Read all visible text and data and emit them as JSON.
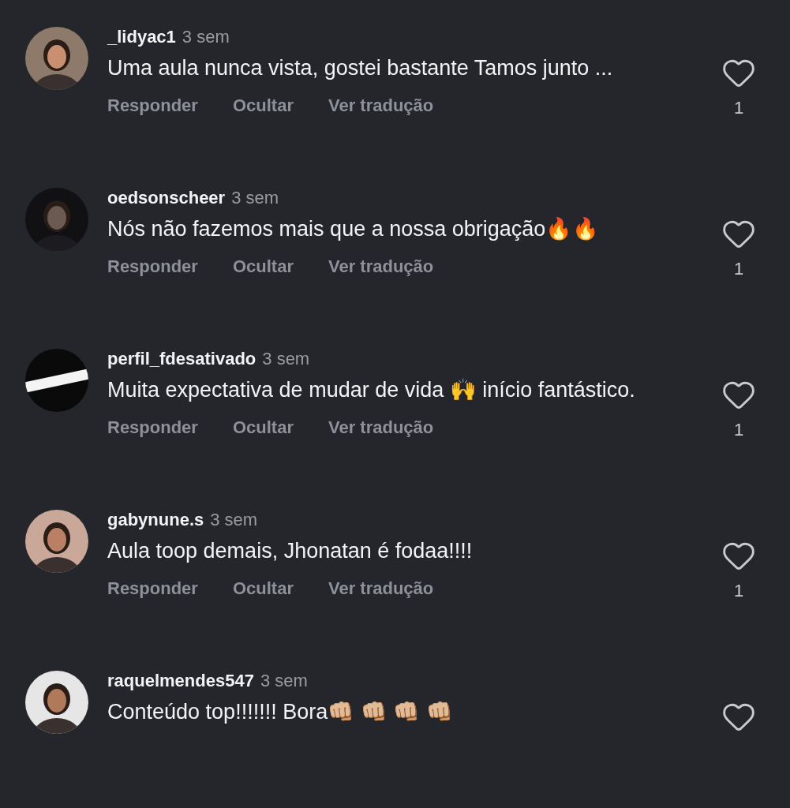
{
  "comments": [
    {
      "username": "_lidyac1",
      "time": "3 sem",
      "text": "Uma aula nunca vista, gostei bastante  Tamos junto ...",
      "actions": [
        "Responder",
        "Ocultar",
        "Ver tradução"
      ],
      "likes": "1",
      "liked": false
    },
    {
      "username": "oedsonscheer",
      "time": "3 sem",
      "text": "Nós não fazemos mais que a nossa obrigação🔥🔥",
      "actions": [
        "Responder",
        "Ocultar",
        "Ver tradução"
      ],
      "likes": "1",
      "liked": false
    },
    {
      "username": "perfil_fdesativado",
      "time": "3 sem",
      "text": "Muita expectativa de mudar de vida 🙌 início fantástico.",
      "actions": [
        "Responder",
        "Ocultar",
        "Ver tradução"
      ],
      "likes": "1",
      "liked": false
    },
    {
      "username": "gabynune.s",
      "time": "3 sem",
      "text": "Aula toop demais, Jhonatan é fodaa!!!!",
      "actions": [
        "Responder",
        "Ocultar",
        "Ver tradução"
      ],
      "likes": "1",
      "liked": false
    },
    {
      "username": "raquelmendes547",
      "time": "3 sem",
      "text": "Conteúdo top!!!!!!! Bora👊🏼 👊🏼 👊🏼 👊🏼",
      "liked": false
    }
  ]
}
